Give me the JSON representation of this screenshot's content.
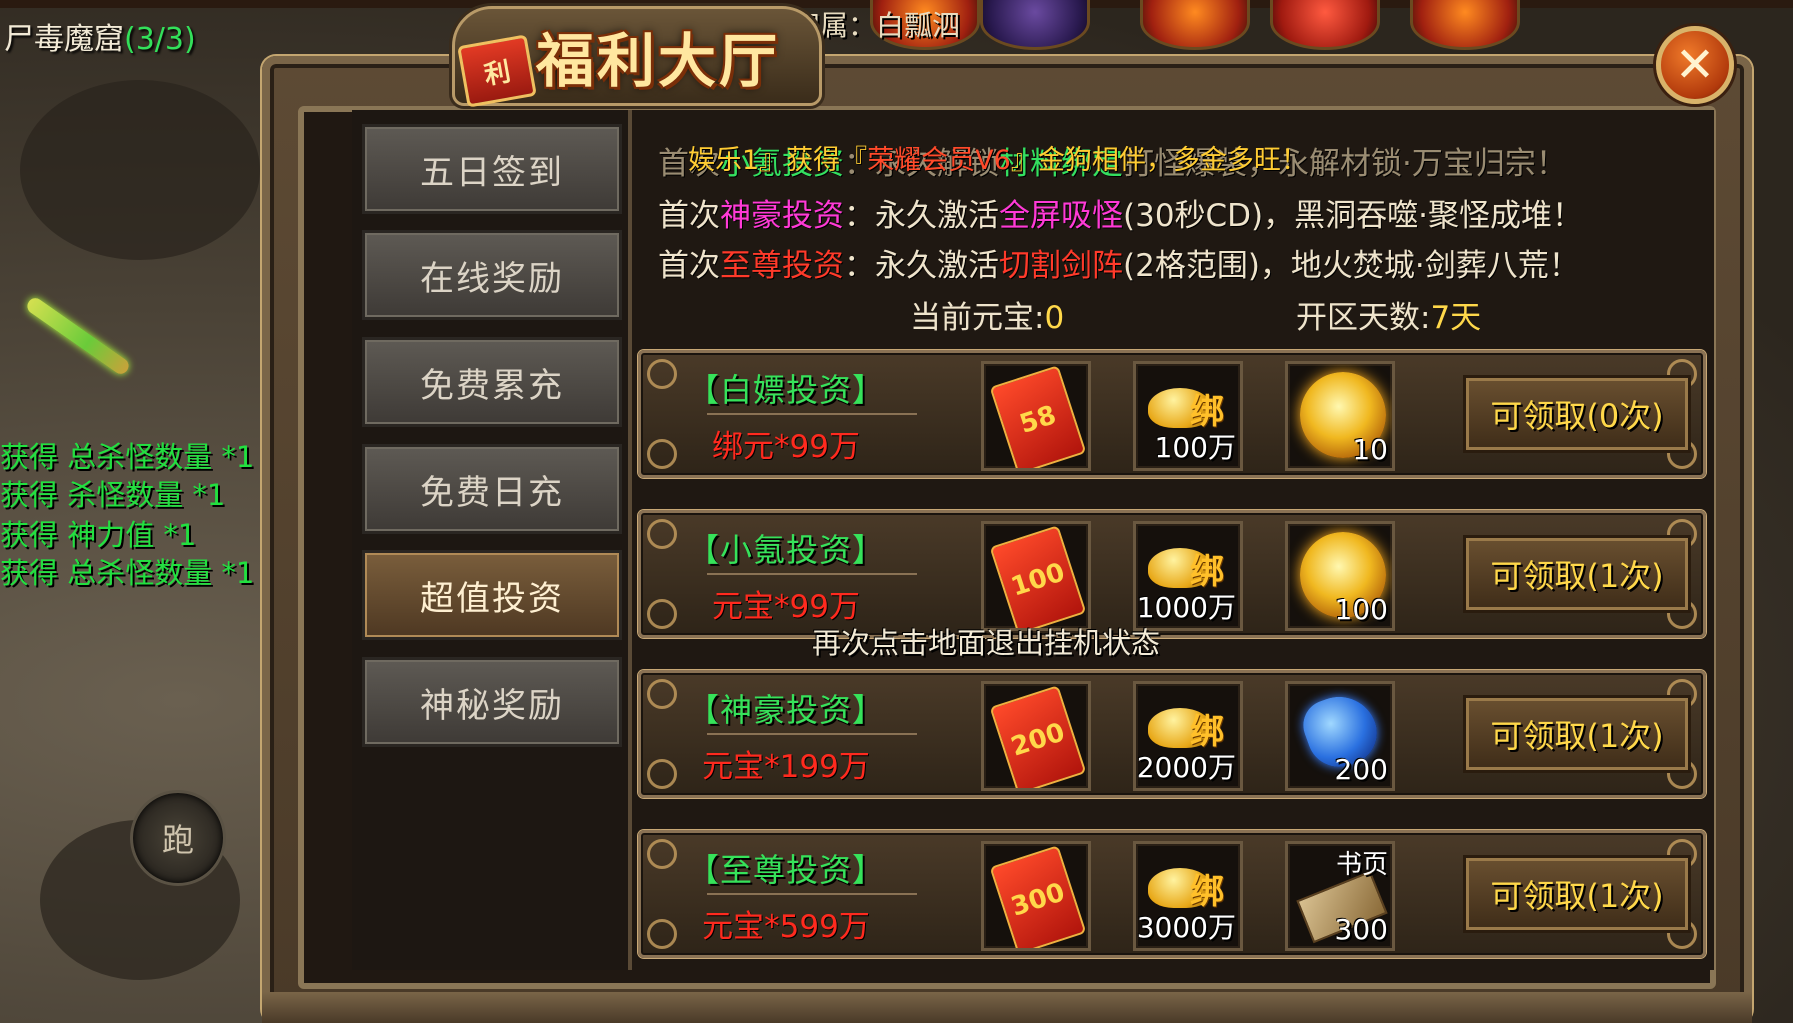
{
  "scene": {
    "quest_title": "尸毒魔窟",
    "quest_count": "(3/3)",
    "belong_text": "归属：白瓢泗",
    "log_lines": [
      "获得 总杀怪数量 *1",
      "获得 杀怪数量 *1",
      "获得 神力值 *1",
      "获得 总杀怪数量 *1"
    ],
    "run_label": "跑"
  },
  "panel": {
    "title": "福利大厅",
    "title_tag": "利",
    "close_label": "✕"
  },
  "sidebar": {
    "tabs": [
      {
        "label": "五日签到",
        "active": false
      },
      {
        "label": "在线奖励",
        "active": false
      },
      {
        "label": "免费累充",
        "active": false
      },
      {
        "label": "免费日充",
        "active": false
      },
      {
        "label": "超值投资",
        "active": true
      },
      {
        "label": "神秘奖励",
        "active": false
      }
    ]
  },
  "marquee": {
    "part1": "娱乐1』获得『",
    "part2": "荣耀会员V6",
    "part3": "』金狗相伴，多金多旺！"
  },
  "info": {
    "row1_a": "首次",
    "row1_b": "小氪投资",
    "row1_c": "：永久解锁",
    "row1_d": "材料绑定",
    "row1_e": "打怪爆装，永解材锁·万宝归宗！",
    "row2_a": "首次",
    "row2_b": "神豪投资",
    "row2_c": "：永久激活",
    "row2_d": "全屏吸怪",
    "row2_e": "(30秒CD)，黑洞吞噬·聚怪成堆！",
    "row3_a": "首次",
    "row3_b": "至尊投资",
    "row3_c": "：永久激活",
    "row3_d": "切割剑阵",
    "row3_e": "(2格范围)，地火焚城·剑葬八荒！",
    "yuanbao_label": "当前元宝:",
    "yuanbao_value": "0",
    "days_label": "开区天数:",
    "days_value": "7天"
  },
  "tiers": [
    {
      "name": "【白嫖投资】",
      "cost": "绑元*99万",
      "envelope": "58",
      "ingot_qty": "100万",
      "item3": "orb",
      "item3_qty": "10",
      "item3_label": "",
      "claim": "可领取(0次)"
    },
    {
      "name": "【小氪投资】",
      "cost": "元宝*99万",
      "envelope": "100",
      "ingot_qty": "1000万",
      "item3": "orb",
      "item3_qty": "100",
      "item3_label": "",
      "claim": "可领取(1次)"
    },
    {
      "name": "【神豪投资】",
      "cost": "元宝*199万",
      "envelope": "200",
      "ingot_qty": "2000万",
      "item3": "gem",
      "item3_qty": "200",
      "item3_label": "",
      "claim": "可领取(1次)"
    },
    {
      "name": "【至尊投资】",
      "cost": "元宝*599万",
      "envelope": "300",
      "ingot_qty": "3000万",
      "item3": "scroll",
      "item3_qty": "300",
      "item3_label": "书页",
      "claim": "可领取(1次)"
    }
  ],
  "bind_mark": "绑",
  "hint": "再次点击地面退出挂机状态",
  "colors": {
    "green": "#34e060",
    "red": "#ff2a1e",
    "gold": "#ffd84a",
    "pink": "#ff3ad6"
  }
}
